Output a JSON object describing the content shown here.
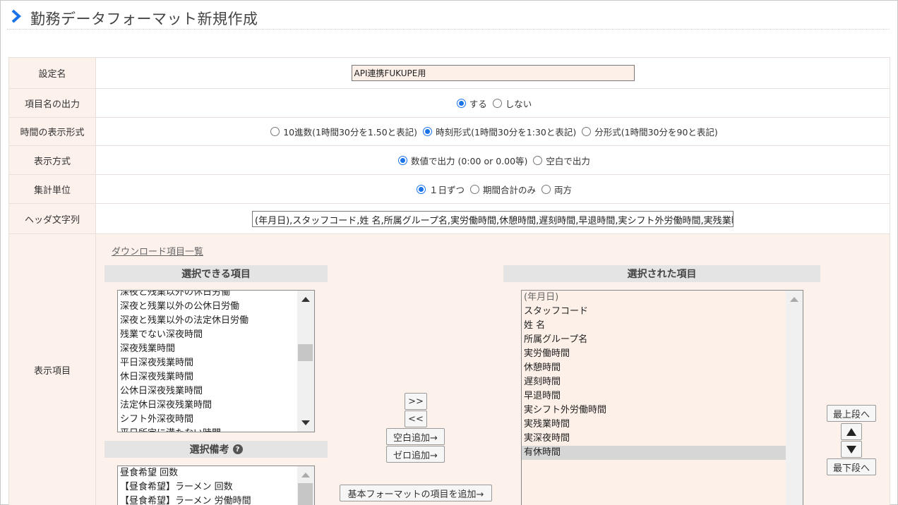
{
  "page": {
    "title": "勤務データフォーマット新規作成"
  },
  "form": {
    "setting_name": {
      "label": "設定名",
      "value": "API連携FUKUPE用"
    },
    "item_name_output": {
      "label": "項目名の出力",
      "options": [
        {
          "label": "する",
          "checked": true
        },
        {
          "label": "しない",
          "checked": false
        }
      ]
    },
    "time_format": {
      "label": "時間の表示形式",
      "options": [
        {
          "label": "10進数(1時間30分を1.50と表記)",
          "checked": false
        },
        {
          "label": "時刻形式(1時間30分を1:30と表記)",
          "checked": true
        },
        {
          "label": "分形式(1時間30分を90と表記)",
          "checked": false
        }
      ]
    },
    "display_method": {
      "label": "表示方式",
      "options": [
        {
          "label": "数値で出力 (0:00 or 0.00等)",
          "checked": true
        },
        {
          "label": "空白で出力",
          "checked": false
        }
      ]
    },
    "aggregation_unit": {
      "label": "集計単位",
      "options": [
        {
          "label": "１日ずつ",
          "checked": true
        },
        {
          "label": "期間合計のみ",
          "checked": false
        },
        {
          "label": "両方",
          "checked": false
        }
      ]
    },
    "header_string": {
      "label": "ヘッダ文字列",
      "value": "(年月日),スタッフコード,姓 名,所属グループ名,実労働時間,休憩時間,遅刻時間,早退時間,実シフト外労働時間,実残業時間,実深夜時間,有休時間"
    },
    "display_items": {
      "label": "表示項目",
      "download_link": "ダウンロード項目一覧",
      "available": {
        "heading": "選択できる項目",
        "items": [
          "深夜と残業以外の休日労働",
          "深夜と残業以外の公休日労働",
          "深夜と残業以外の法定休日労働",
          "残業でない深夜時間",
          "深夜残業時間",
          "平日深夜残業時間",
          "休日深夜残業時間",
          "公休日深夜残業時間",
          "法定休日深夜残業時間",
          "シフト外深夜時間",
          "平日所定に満たない時間"
        ]
      },
      "remarks": {
        "heading": "選択備考",
        "items": [
          "昼食希望 回数",
          "【昼食希望】ラーメン 回数",
          "【昼食希望】ラーメン 労働時間"
        ]
      },
      "selected": {
        "heading": "選択された項目",
        "items": [
          "(年月日)",
          "スタッフコード",
          "姓 名",
          "所属グループ名",
          "実労働時間",
          "休憩時間",
          "遅刻時間",
          "早退時間",
          "実シフト外労働時間",
          "実残業時間",
          "実深夜時間",
          "有休時間"
        ],
        "highlighted": "有休時間"
      },
      "buttons": {
        "add": ">>",
        "remove": "<<",
        "add_blank": "空白追加→",
        "add_zero": "ゼロ追加→",
        "add_basic": "基本フォーマットの項目を追加→",
        "move_top": "最上段へ",
        "move_bottom": "最下段へ"
      }
    }
  },
  "colors": {
    "accent": "#1a73e8",
    "label_bg": "#fdf1ec",
    "input_bg": "#fdf0e8"
  }
}
